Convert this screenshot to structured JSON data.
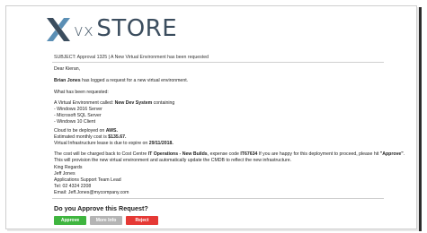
{
  "brand": {
    "prefix": "vx",
    "name": "STORE"
  },
  "colors": {
    "approve": "#3fb53f",
    "more_info": "#b5b5b5",
    "reject": "#e53935",
    "logo_dark": "#3b4d5e",
    "logo_light": "#5b8fb5"
  },
  "subject": "SUBJECT: Approval 1325 | A New Virtual Environment has been requested",
  "greeting": "Dear Kieran,",
  "intro": {
    "name": "Brian Jones",
    "rest": " has logged a request for a new virtual environment."
  },
  "section_title": "What has been requested:",
  "request": {
    "prefix": "A Virtual Environment called: ",
    "env_name": "New Dev System",
    "suffix": " containing",
    "items": [
      "- Windows 2016 Server",
      "- Microsoft SQL Server",
      "- Windows 10 Client"
    ]
  },
  "cloud": {
    "prefix": "Cloud to be deployed on ",
    "value": "AWS."
  },
  "cost": {
    "prefix": "Estimated monthly cost is ",
    "value": "$135.67."
  },
  "lease": {
    "prefix": "Virtual Infrastructure lease is due to expire on ",
    "value": "29/11/2018."
  },
  "charge": {
    "p1": "The cost will be charged back to Cost Centre ",
    "centre": "IT Operations - New Builds",
    "p2": ", expense code ",
    "code": "IT67634",
    "p3": " If you are happy for this deployment to proceed, please hit ",
    "action": "\"Approve\"",
    "p4": ".",
    "line2": "This will provision the new virtual environment and automatically update the CMDB to reflect the new infrastructure."
  },
  "signature": {
    "closing": "King Regards",
    "name": "Jeff Jones",
    "title": "Applications Support Team Lead",
    "tel": "Tel: 02 4324 2208",
    "email": "Email: Jeff.Jones@mycompany.com"
  },
  "question": "Do you Approve this Request?",
  "buttons": {
    "approve": "Approve",
    "more_info": "More Info",
    "reject": "Reject"
  }
}
